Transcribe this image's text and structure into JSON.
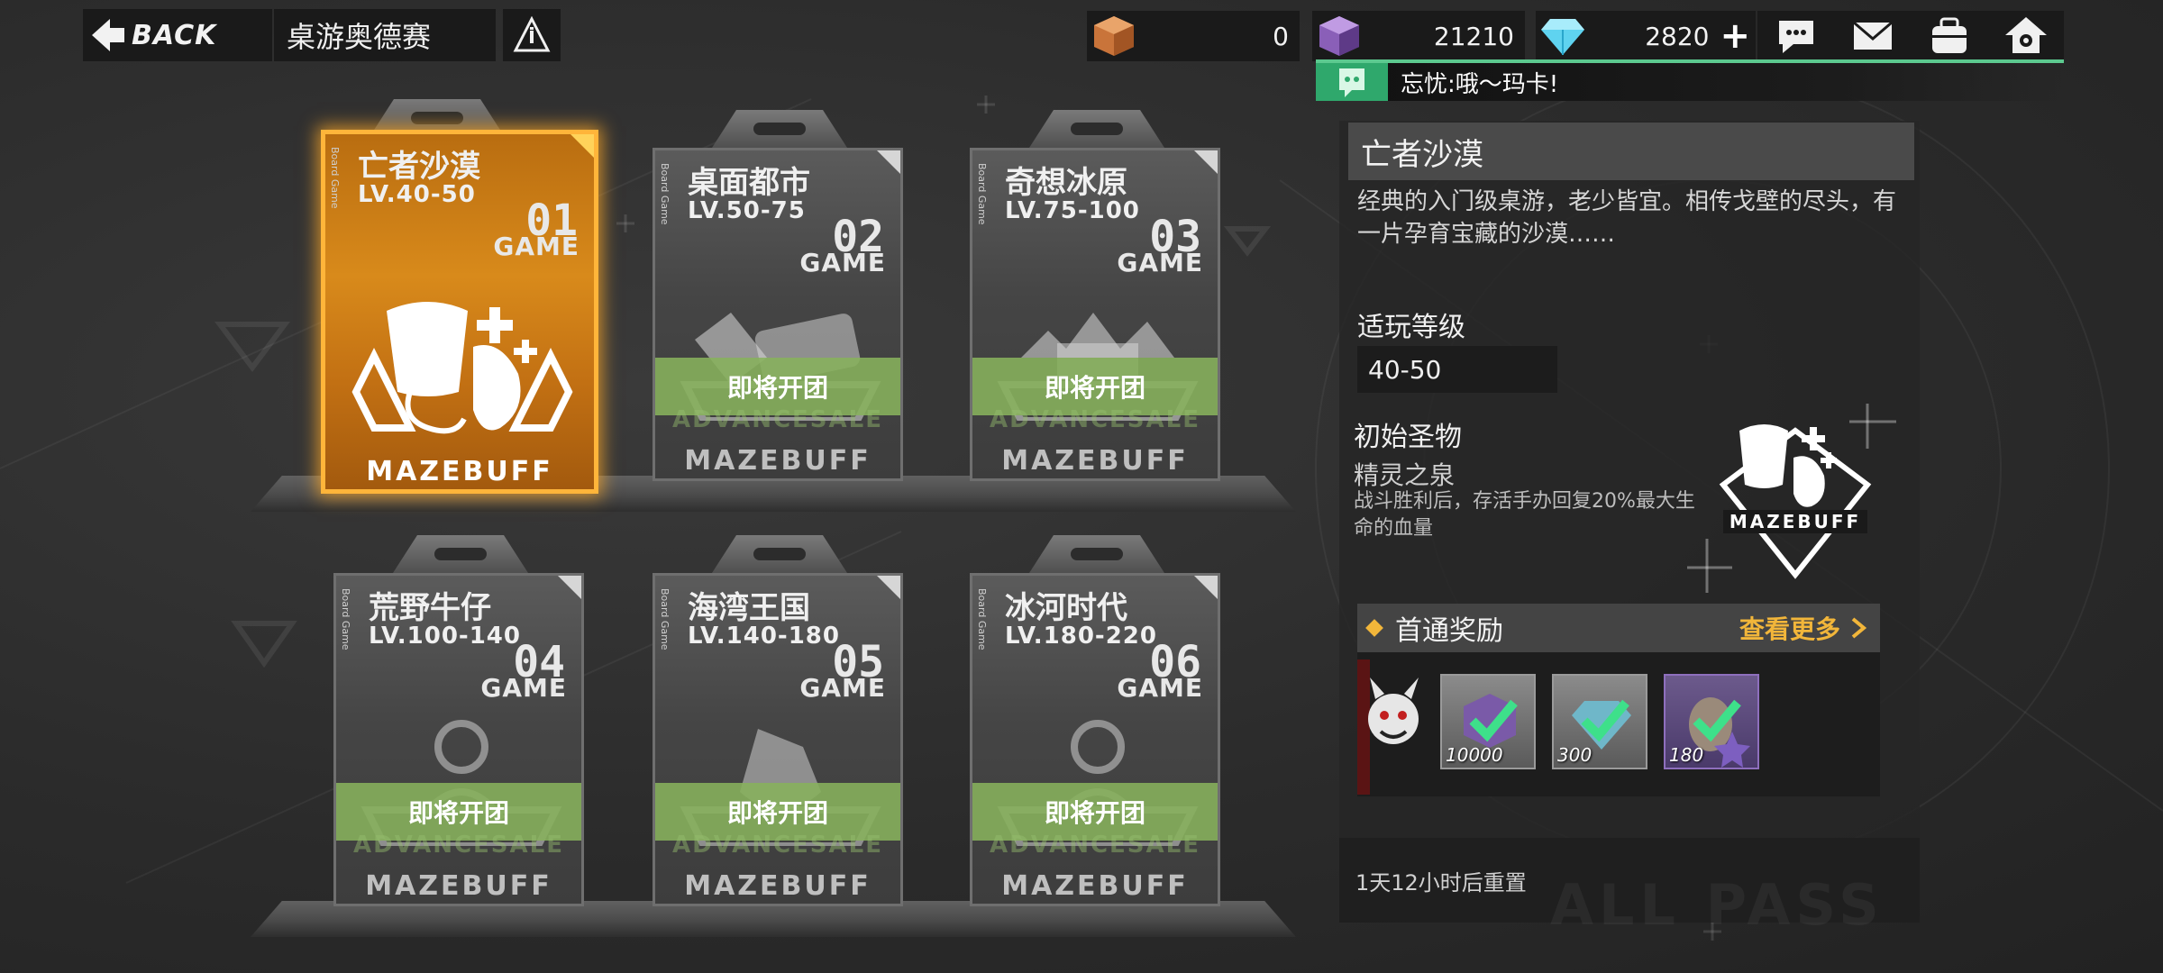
{
  "header": {
    "back_label": "BACK",
    "title": "桌游奥德赛"
  },
  "currencies": [
    {
      "icon": "orange-cube-icon",
      "amount": "0"
    },
    {
      "icon": "purple-cube-icon",
      "amount": "21210"
    },
    {
      "icon": "diamond-icon",
      "amount": "2820"
    }
  ],
  "top_icons": [
    "chat-bubble-icon",
    "mail-icon",
    "backpack-icon",
    "home-icon"
  ],
  "chat": {
    "message": "忘忧:哦～玛卡!"
  },
  "cards": [
    {
      "name": "亡者沙漠",
      "level": "LV.40-50",
      "num": "01",
      "game": "GAME",
      "side": "Board Game",
      "brand": "MAZEBUFF",
      "selected": true
    },
    {
      "name": "桌面都市",
      "level": "LV.50-75",
      "num": "02",
      "game": "GAME",
      "side": "Board Game",
      "brand": "MAZEBUFF",
      "status": "即将开团",
      "strip": "ADVANCESALE"
    },
    {
      "name": "奇想冰原",
      "level": "LV.75-100",
      "num": "03",
      "game": "GAME",
      "side": "Board Game",
      "brand": "MAZEBUFF",
      "status": "即将开团",
      "strip": "ADVANCESALE"
    },
    {
      "name": "荒野牛仔",
      "level": "LV.100-140",
      "num": "04",
      "game": "GAME",
      "side": "Board Game",
      "brand": "MAZEBUFF",
      "status": "即将开团",
      "strip": "ADVANCESALE"
    },
    {
      "name": "海湾王国",
      "level": "LV.140-180",
      "num": "05",
      "game": "GAME",
      "side": "Board Game",
      "brand": "MAZEBUFF",
      "status": "即将开团",
      "strip": "ADVANCESALE"
    },
    {
      "name": "冰河时代",
      "level": "LV.180-220",
      "num": "06",
      "game": "GAME",
      "side": "Board Game",
      "brand": "MAZEBUFF",
      "status": "即将开团",
      "strip": "ADVANCESALE"
    }
  ],
  "detail": {
    "title": "亡者沙漠",
    "description": "经典的入门级桌游，老少皆宜。相传戈壁的尽头，有一片孕育宝藏的沙漠……",
    "level_label": "适玩等级",
    "level_value": "40-50",
    "relic_label": "初始圣物",
    "relic_name": "精灵之泉",
    "relic_desc": "战斗胜利后，存活手办回复20%最大生命的血量",
    "relic_brand": "MAZEBUFF",
    "reward_label": "首通奖励",
    "see_more": "查看更多",
    "rewards": [
      {
        "qty": "10000",
        "icon": "purple-cube-icon"
      },
      {
        "qty": "300",
        "icon": "diamond-icon"
      },
      {
        "qty": "180",
        "icon": "figure-token-icon"
      }
    ],
    "reset_text": "1天12小时后重置",
    "watermark": "ALL PASS"
  },
  "colors": {
    "accent_orange": "#ffb53a",
    "soon_green": "#88b25c",
    "online_green": "#5cc98f",
    "gold": "#f2b63a"
  }
}
